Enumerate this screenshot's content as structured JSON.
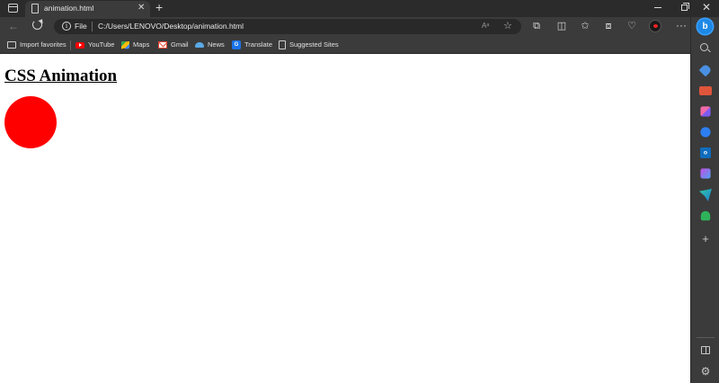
{
  "browser": {
    "tab": {
      "title": "animation.html",
      "close_glyph": "✕"
    },
    "new_tab_glyph": "+",
    "window_controls": {
      "close_glyph": "✕"
    },
    "address_bar": {
      "scheme_label": "File",
      "url": "C:/Users/LENOVO/Desktop/animation.html",
      "info_glyph": "i",
      "read_aloud_glyph": "Aᵃ"
    },
    "favorites": [
      {
        "label": "Import favorites",
        "icon": "import-icon"
      },
      {
        "label": "YouTube",
        "icon": "youtube-icon"
      },
      {
        "label": "Maps",
        "icon": "maps-icon"
      },
      {
        "label": "Gmail",
        "icon": "gmail-icon"
      },
      {
        "label": "News",
        "icon": "news-icon"
      },
      {
        "label": "Translate",
        "icon": "translate-icon"
      },
      {
        "label": "Suggested Sites",
        "icon": "page-icon"
      }
    ],
    "sidebar_bing_glyph": "b",
    "sidebar_add_glyph": "+",
    "sidebar_settings_glyph": "⚙"
  },
  "page": {
    "heading": "CSS Animation",
    "ball_color": "#ff0000"
  },
  "colors": {
    "chrome_dark": "#2b2b2b",
    "chrome": "#3b3b3b",
    "page_background": "#ffffff"
  }
}
